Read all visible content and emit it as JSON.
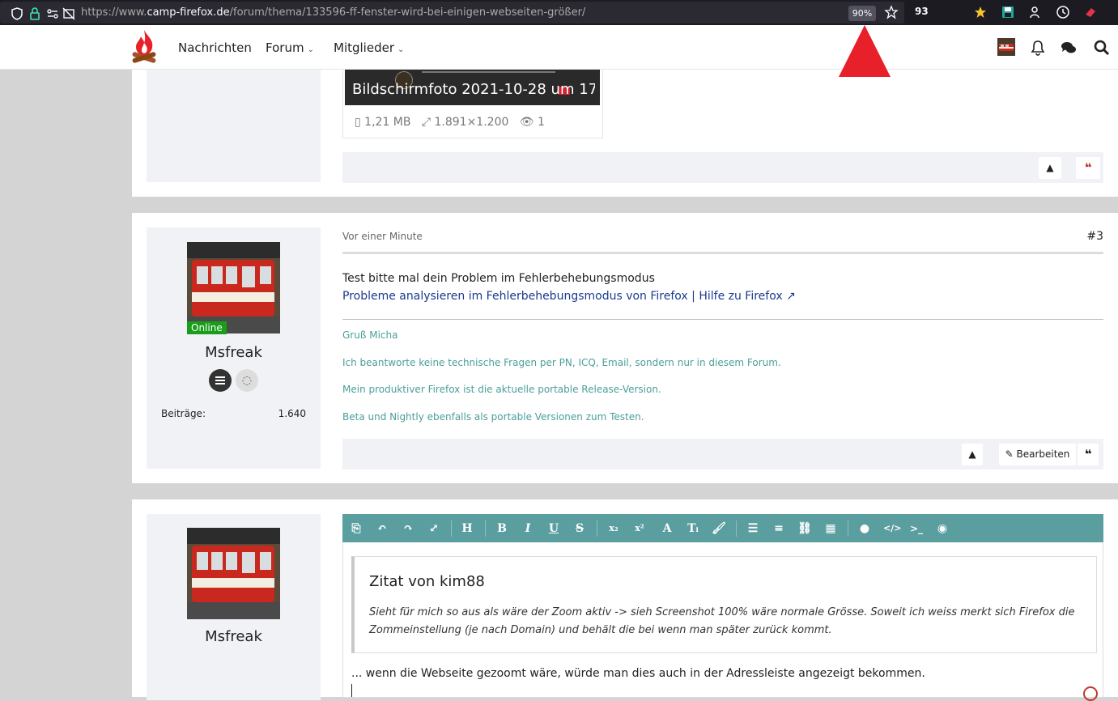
{
  "browser": {
    "url_prefix": "https://www.",
    "url_domain": "camp-firefox.de",
    "url_path": "/forum/thema/133596-ff-fenster-wird-bei-einigen-webseiten-größer/",
    "zoom": "90%",
    "extension_badge": "93"
  },
  "header": {
    "nav": [
      {
        "label": "Nachrichten"
      },
      {
        "label": "Forum"
      },
      {
        "label": "Mitglieder"
      }
    ]
  },
  "post1": {
    "attachment_title": "Bildschirmfoto 2021-10-28 um 17....",
    "attachment_size": "1,21 MB",
    "attachment_dims": "1.891×1.200",
    "attachment_views": "1"
  },
  "post2": {
    "time": "Vor einer Minute",
    "number": "#3",
    "online_badge": "Online",
    "username": "Msfreak",
    "stat_label": "Beiträge",
    "stat_value": "1.640",
    "body_line": "Test bitte mal dein Problem im Fehlerbehebungsmodus",
    "link_text": "Probleme analysieren im Fehlerbehebungsmodus von Firefox | Hilfe zu Firefox",
    "signature": [
      "Gruß Micha",
      "Ich beantworte keine technische Fragen per PN, ICQ, Email, sondern nur in diesem Forum.",
      "Mein produktiver Firefox ist die aktuelle portable Release-Version.",
      "Beta und Nightly ebenfalls als portable Versionen zum Testen."
    ],
    "edit_label": "Bearbeiten"
  },
  "reply": {
    "username": "Msfreak",
    "quote_title": "Zitat von kim88",
    "quote_text": "Sieht für mich so aus als wäre der Zoom aktiv -> sieh Screenshot 100% wäre normale Grösse. Soweit ich weiss merkt sich Firefox die Zommeinstellung (je nach Domain) und behält die bei wenn man später zurück kommt.",
    "reply_text": "... wenn die Webseite gezoomt wäre, würde man dies auch in der Adressleiste angezeigt bekommen.",
    "toolbar_text_buttons": {
      "heading": "H",
      "bold": "B",
      "italic": "I",
      "underline": "U",
      "strike": "S",
      "font": "A",
      "size": "Tᵢ"
    }
  },
  "colors": {
    "accent_teal": "#5b9ea0",
    "link_blue": "#1a3a8f",
    "online_green": "#1a9d1a",
    "quote_red": "#c0392b",
    "annotation_red": "#e8202a"
  }
}
